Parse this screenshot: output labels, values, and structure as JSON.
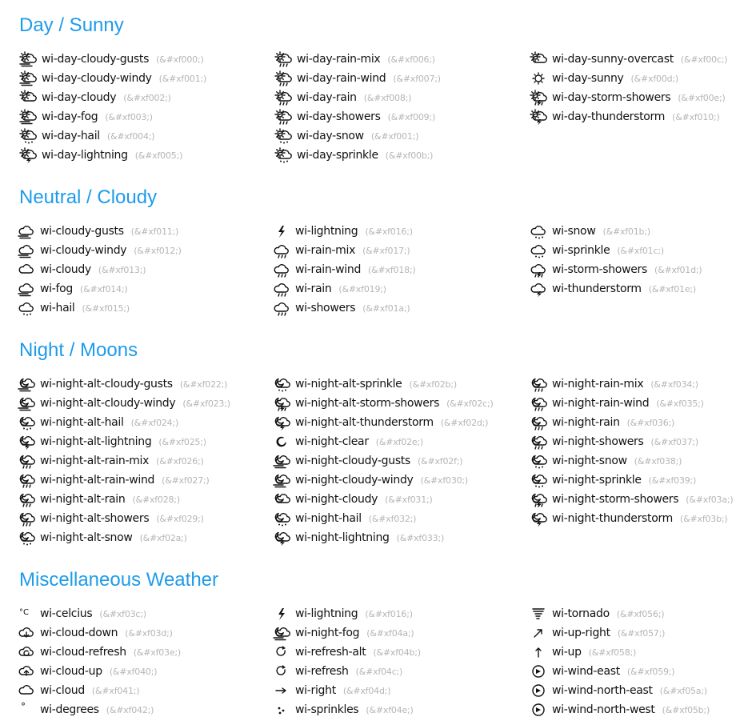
{
  "sections": [
    {
      "title": "Day / Sunny",
      "columns": [
        [
          {
            "name": "wi-day-cloudy-gusts",
            "code": "(&#xf000;)",
            "icon": "day-cloudy-gusts-icon"
          },
          {
            "name": "wi-day-cloudy-windy",
            "code": "(&#xf001;)",
            "icon": "day-cloudy-windy-icon"
          },
          {
            "name": "wi-day-cloudy",
            "code": "(&#xf002;)",
            "icon": "day-cloudy-icon"
          },
          {
            "name": "wi-day-fog",
            "code": "(&#xf003;)",
            "icon": "day-fog-icon"
          },
          {
            "name": "wi-day-hail",
            "code": "(&#xf004;)",
            "icon": "day-hail-icon"
          },
          {
            "name": "wi-day-lightning",
            "code": "(&#xf005;)",
            "icon": "day-lightning-icon"
          }
        ],
        [
          {
            "name": "wi-day-rain-mix",
            "code": "(&#xf006;)",
            "icon": "day-rain-mix-icon"
          },
          {
            "name": "wi-day-rain-wind",
            "code": "(&#xf007;)",
            "icon": "day-rain-wind-icon"
          },
          {
            "name": "wi-day-rain",
            "code": "(&#xf008;)",
            "icon": "day-rain-icon"
          },
          {
            "name": "wi-day-showers",
            "code": "(&#xf009;)",
            "icon": "day-showers-icon"
          },
          {
            "name": "wi-day-snow",
            "code": "(&#xf001;)",
            "icon": "day-snow-icon"
          },
          {
            "name": "wi-day-sprinkle",
            "code": "(&#xf00b;)",
            "icon": "day-sprinkle-icon"
          }
        ],
        [
          {
            "name": "wi-day-sunny-overcast",
            "code": "(&#xf00c;)",
            "icon": "day-sunny-overcast-icon"
          },
          {
            "name": "wi-day-sunny",
            "code": "(&#xf00d;)",
            "icon": "day-sunny-icon"
          },
          {
            "name": "wi-day-storm-showers",
            "code": "(&#xf00e;)",
            "icon": "day-storm-showers-icon"
          },
          {
            "name": "wi-day-thunderstorm",
            "code": "(&#xf010;)",
            "icon": "day-thunderstorm-icon"
          }
        ]
      ]
    },
    {
      "title": "Neutral / Cloudy",
      "columns": [
        [
          {
            "name": "wi-cloudy-gusts",
            "code": "(&#xf011;)",
            "icon": "cloudy-gusts-icon"
          },
          {
            "name": "wi-cloudy-windy",
            "code": "(&#xf012;)",
            "icon": "cloudy-windy-icon"
          },
          {
            "name": "wi-cloudy",
            "code": "(&#xf013;)",
            "icon": "cloudy-icon"
          },
          {
            "name": "wi-fog",
            "code": "(&#xf014;)",
            "icon": "fog-icon"
          },
          {
            "name": "wi-hail",
            "code": "(&#xf015;)",
            "icon": "hail-icon"
          }
        ],
        [
          {
            "name": "wi-lightning",
            "code": "(&#xf016;)",
            "icon": "lightning-icon"
          },
          {
            "name": "wi-rain-mix",
            "code": "(&#xf017;)",
            "icon": "rain-mix-icon"
          },
          {
            "name": "wi-rain-wind",
            "code": "(&#xf018;)",
            "icon": "rain-wind-icon"
          },
          {
            "name": "wi-rain",
            "code": "(&#xf019;)",
            "icon": "rain-icon"
          },
          {
            "name": "wi-showers",
            "code": "(&#xf01a;)",
            "icon": "showers-icon"
          }
        ],
        [
          {
            "name": "wi-snow",
            "code": "(&#xf01b;)",
            "icon": "snow-icon"
          },
          {
            "name": "wi-sprinkle",
            "code": "(&#xf01c;)",
            "icon": "sprinkle-icon"
          },
          {
            "name": "wi-storm-showers",
            "code": "(&#xf01d;)",
            "icon": "storm-showers-icon"
          },
          {
            "name": "wi-thunderstorm",
            "code": "(&#xf01e;)",
            "icon": "thunderstorm-icon"
          }
        ]
      ]
    },
    {
      "title": "Night / Moons",
      "columns": [
        [
          {
            "name": "wi-night-alt-cloudy-gusts",
            "code": "(&#xf022;)",
            "icon": "night-alt-cloudy-gusts-icon"
          },
          {
            "name": "wi-night-alt-cloudy-windy",
            "code": "(&#xf023;)",
            "icon": "night-alt-cloudy-windy-icon"
          },
          {
            "name": "wi-night-alt-hail",
            "code": "(&#xf024;)",
            "icon": "night-alt-hail-icon"
          },
          {
            "name": "wi-night-alt-lightning",
            "code": "(&#xf025;)",
            "icon": "night-alt-lightning-icon"
          },
          {
            "name": "wi-night-alt-rain-mix",
            "code": "(&#xf026;)",
            "icon": "night-alt-rain-mix-icon"
          },
          {
            "name": "wi-night-alt-rain-wind",
            "code": "(&#xf027;)",
            "icon": "night-alt-rain-wind-icon"
          },
          {
            "name": "wi-night-alt-rain",
            "code": "(&#xf028;)",
            "icon": "night-alt-rain-icon"
          },
          {
            "name": "wi-night-alt-showers",
            "code": "(&#xf029;)",
            "icon": "night-alt-showers-icon"
          },
          {
            "name": "wi-night-alt-snow",
            "code": "(&#xf02a;)",
            "icon": "night-alt-snow-icon"
          }
        ],
        [
          {
            "name": "wi-night-alt-sprinkle",
            "code": "(&#xf02b;)",
            "icon": "night-alt-sprinkle-icon"
          },
          {
            "name": "wi-night-alt-storm-showers",
            "code": "(&#xf02c;)",
            "icon": "night-alt-storm-showers-icon"
          },
          {
            "name": "wi-night-alt-thunderstorm",
            "code": "(&#xf02d;)",
            "icon": "night-alt-thunderstorm-icon"
          },
          {
            "name": "wi-night-clear",
            "code": "(&#xf02e;)",
            "icon": "night-clear-icon"
          },
          {
            "name": "wi-night-cloudy-gusts",
            "code": "(&#xf02f;)",
            "icon": "night-cloudy-gusts-icon"
          },
          {
            "name": "wi-night-cloudy-windy",
            "code": "(&#xf030;)",
            "icon": "night-cloudy-windy-icon"
          },
          {
            "name": "wi-night-cloudy",
            "code": "(&#xf031;)",
            "icon": "night-cloudy-icon"
          },
          {
            "name": "wi-night-hail",
            "code": "(&#xf032;)",
            "icon": "night-hail-icon"
          },
          {
            "name": "wi-night-lightning",
            "code": "(&#xf033;)",
            "icon": "night-lightning-icon"
          }
        ],
        [
          {
            "name": "wi-night-rain-mix",
            "code": "(&#xf034;)",
            "icon": "night-rain-mix-icon"
          },
          {
            "name": "wi-night-rain-wind",
            "code": "(&#xf035;)",
            "icon": "night-rain-wind-icon"
          },
          {
            "name": "wi-night-rain",
            "code": "(&#xf036;)",
            "icon": "night-rain-icon"
          },
          {
            "name": "wi-night-showers",
            "code": "(&#xf037;)",
            "icon": "night-showers-icon"
          },
          {
            "name": "wi-night-snow",
            "code": "(&#xf038;)",
            "icon": "night-snow-icon"
          },
          {
            "name": "wi-night-sprinkle",
            "code": "(&#xf039;)",
            "icon": "night-sprinkle-icon"
          },
          {
            "name": "wi-night-storm-showers",
            "code": "(&#xf03a;)",
            "icon": "night-storm-showers-icon"
          },
          {
            "name": "wi-night-thunderstorm",
            "code": "(&#xf03b;)",
            "icon": "night-thunderstorm-icon"
          }
        ]
      ]
    },
    {
      "title": "Miscellaneous Weather",
      "columns": [
        [
          {
            "name": "wi-celcius",
            "code": "(&#xf03c;)",
            "icon": "celcius-icon"
          },
          {
            "name": "wi-cloud-down",
            "code": "(&#xf03d;)",
            "icon": "cloud-down-icon"
          },
          {
            "name": "wi-cloud-refresh",
            "code": "(&#xf03e;)",
            "icon": "cloud-refresh-icon"
          },
          {
            "name": "wi-cloud-up",
            "code": "(&#xf040;)",
            "icon": "cloud-up-icon"
          },
          {
            "name": "wi-cloud",
            "code": "(&#xf041;)",
            "icon": "cloud-icon"
          },
          {
            "name": "wi-degrees",
            "code": "(&#xf042;)",
            "icon": "degrees-icon"
          }
        ],
        [
          {
            "name": "wi-lightning",
            "code": "(&#xf016;)",
            "icon": "lightning-icon"
          },
          {
            "name": "wi-night-fog",
            "code": "(&#xf04a;)",
            "icon": "night-fog-icon"
          },
          {
            "name": "wi-refresh-alt",
            "code": "(&#xf04b;)",
            "icon": "refresh-alt-icon"
          },
          {
            "name": "wi-refresh",
            "code": "(&#xf04c;)",
            "icon": "refresh-icon"
          },
          {
            "name": "wi-right",
            "code": "(&#xf04d;)",
            "icon": "right-icon"
          },
          {
            "name": "wi-sprinkles",
            "code": "(&#xf04e;)",
            "icon": "sprinkles-icon"
          }
        ],
        [
          {
            "name": "wi-tornado",
            "code": "(&#xf056;)",
            "icon": "tornado-icon"
          },
          {
            "name": "wi-up-right",
            "code": "(&#xf057;)",
            "icon": "up-right-icon"
          },
          {
            "name": "wi-up",
            "code": "(&#xf058;)",
            "icon": "up-icon"
          },
          {
            "name": "wi-wind-east",
            "code": "(&#xf059;)",
            "icon": "wind-east-icon"
          },
          {
            "name": "wi-wind-north-east",
            "code": "(&#xf05a;)",
            "icon": "wind-north-east-icon"
          },
          {
            "name": "wi-wind-north-west",
            "code": "(&#xf05b;)",
            "icon": "wind-north-west-icon"
          }
        ]
      ]
    }
  ],
  "colors": {
    "heading": "#1e9bea",
    "name": "#111111",
    "code": "#b5b5b5"
  }
}
